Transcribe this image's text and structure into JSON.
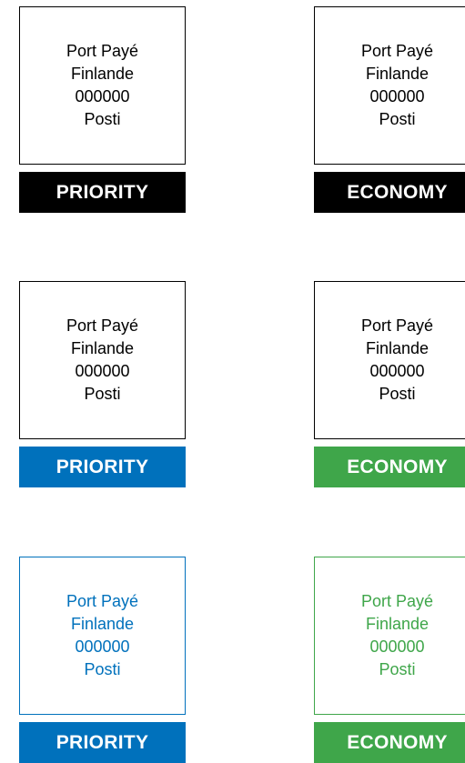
{
  "labels": [
    {
      "stamp_lines": [
        "Port Payé",
        "Finlande",
        "000000",
        "Posti"
      ],
      "band_text": "PRIORITY",
      "band_color": "#000000",
      "stamp_color": "#000000"
    },
    {
      "stamp_lines": [
        "Port Payé",
        "Finlande",
        "000000",
        "Posti"
      ],
      "band_text": "ECONOMY",
      "band_color": "#000000",
      "stamp_color": "#000000"
    },
    {
      "stamp_lines": [
        "Port Payé",
        "Finlande",
        "000000",
        "Posti"
      ],
      "band_text": "PRIORITY",
      "band_color": "#0071bc",
      "stamp_color": "#000000"
    },
    {
      "stamp_lines": [
        "Port Payé",
        "Finlande",
        "000000",
        "Posti"
      ],
      "band_text": "ECONOMY",
      "band_color": "#3fa64a",
      "stamp_color": "#000000"
    },
    {
      "stamp_lines": [
        "Port Payé",
        "Finlande",
        "000000",
        "Posti"
      ],
      "band_text": "PRIORITY",
      "band_color": "#0071bc",
      "stamp_color": "#0071bc"
    },
    {
      "stamp_lines": [
        "Port Payé",
        "Finlande",
        "000000",
        "Posti"
      ],
      "band_text": "ECONOMY",
      "band_color": "#3fa64a",
      "stamp_color": "#3fa64a"
    }
  ]
}
